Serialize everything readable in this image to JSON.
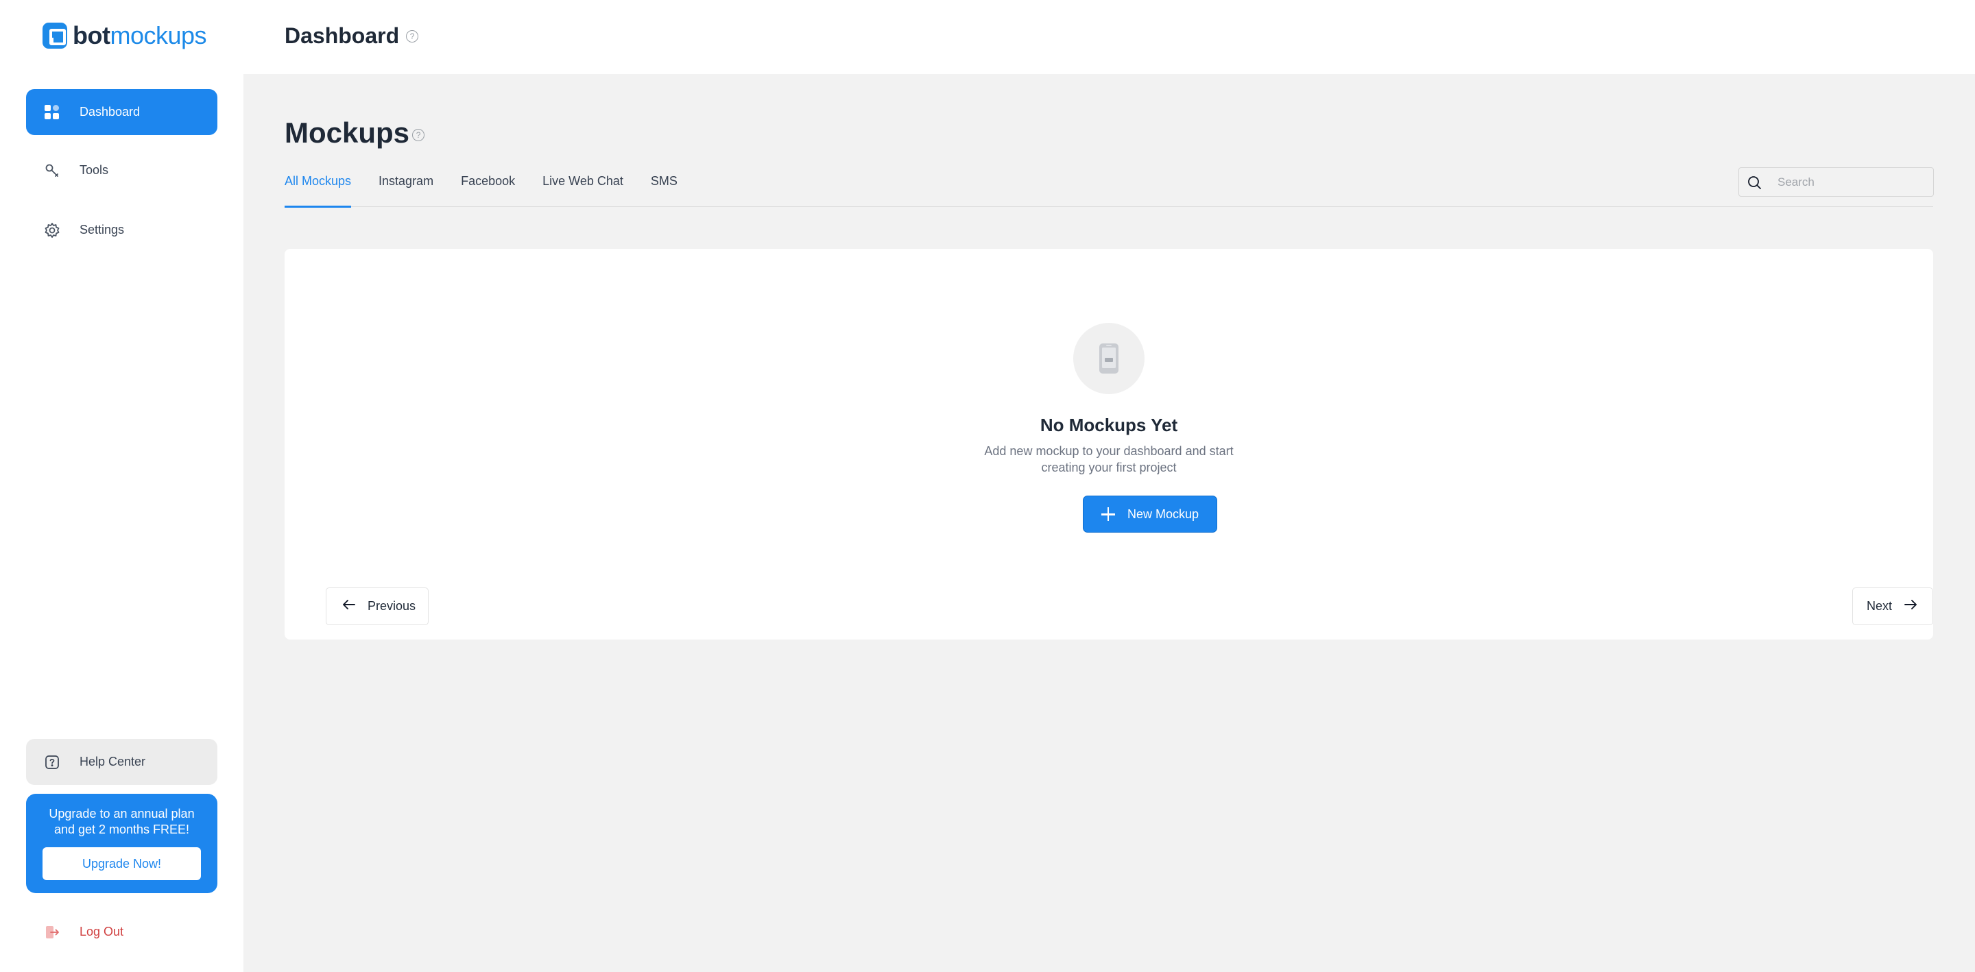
{
  "brand": {
    "name_bold": "bot",
    "name_light": "mockups",
    "color": "#1d8ae8"
  },
  "sidebar": {
    "items": [
      {
        "label": "Dashboard",
        "icon": "grid-icon",
        "active": true
      },
      {
        "label": "Tools",
        "icon": "wrench-icon",
        "active": false
      },
      {
        "label": "Settings",
        "icon": "gear-icon",
        "active": false
      }
    ],
    "help_label": "Help Center",
    "upgrade": {
      "text": "Upgrade to an annual plan and get 2 months FREE!",
      "button_label": "Upgrade Now!"
    },
    "logout_label": "Log Out"
  },
  "header": {
    "title": "Dashboard"
  },
  "main": {
    "title": "Mockups",
    "tabs": [
      {
        "label": "All Mockups",
        "active": true
      },
      {
        "label": "Instagram",
        "active": false
      },
      {
        "label": "Facebook",
        "active": false
      },
      {
        "label": "Live Web Chat",
        "active": false
      },
      {
        "label": "SMS",
        "active": false
      }
    ],
    "search": {
      "placeholder": "Search",
      "value": ""
    },
    "empty_state": {
      "icon": "phone-icon",
      "title": "No Mockups Yet",
      "description": "Add new mockup to your dashboard and start creating your first project",
      "button_label": "New Mockup"
    },
    "pagination": {
      "previous_label": "Previous",
      "next_label": "Next"
    }
  },
  "colors": {
    "accent": "#1d86ee",
    "background": "#f2f2f2",
    "danger": "#d04040"
  }
}
